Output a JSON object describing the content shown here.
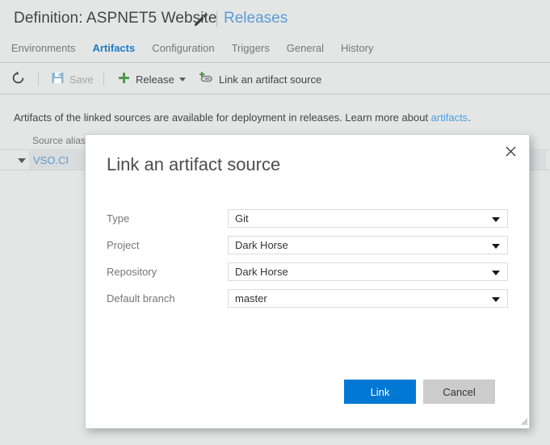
{
  "header": {
    "definition_title": "Definition: ASPNET5 Website",
    "edit_icon": "pencil-icon",
    "releases_link": "Releases",
    "tabs": [
      {
        "label": "Environments",
        "active": false
      },
      {
        "label": "Artifacts",
        "active": true
      },
      {
        "label": "Configuration",
        "active": false
      },
      {
        "label": "Triggers",
        "active": false
      },
      {
        "label": "General",
        "active": false
      },
      {
        "label": "History",
        "active": false
      }
    ]
  },
  "toolbar": {
    "refresh_icon": "refresh-icon",
    "save_label": "Save",
    "save_icon": "save-floppy-icon",
    "release_label": "Release",
    "release_icon": "plus-icon",
    "link_artifact_label": "Link an artifact source",
    "link_artifact_icon": "link-add-icon"
  },
  "info": {
    "text_before": "Artifacts of the linked sources are available for deployment in releases. Learn more about ",
    "link_text": "artifacts",
    "text_after": "."
  },
  "grid": {
    "columns": [
      "Source alias"
    ],
    "rows": [
      {
        "source_alias": "VSO.CI",
        "expanded": true
      }
    ]
  },
  "modal": {
    "title": "Link an artifact source",
    "close_icon": "close-icon",
    "fields": [
      {
        "label": "Type",
        "value": "Git"
      },
      {
        "label": "Project",
        "value": "Dark Horse"
      },
      {
        "label": "Repository",
        "value": "Dark Horse"
      },
      {
        "label": "Default branch",
        "value": "master"
      }
    ],
    "primary_button": "Link",
    "secondary_button": "Cancel",
    "resize_grip_icon": "resize-grip-icon"
  },
  "colors": {
    "page_background": "#e4e6e6",
    "accent_blue": "#0078d4",
    "link_blue": "#5b9bd5",
    "tab_active_blue": "#1b7ac4",
    "plus_green": "#4c9a4c",
    "modal_background": "#ffffff"
  }
}
